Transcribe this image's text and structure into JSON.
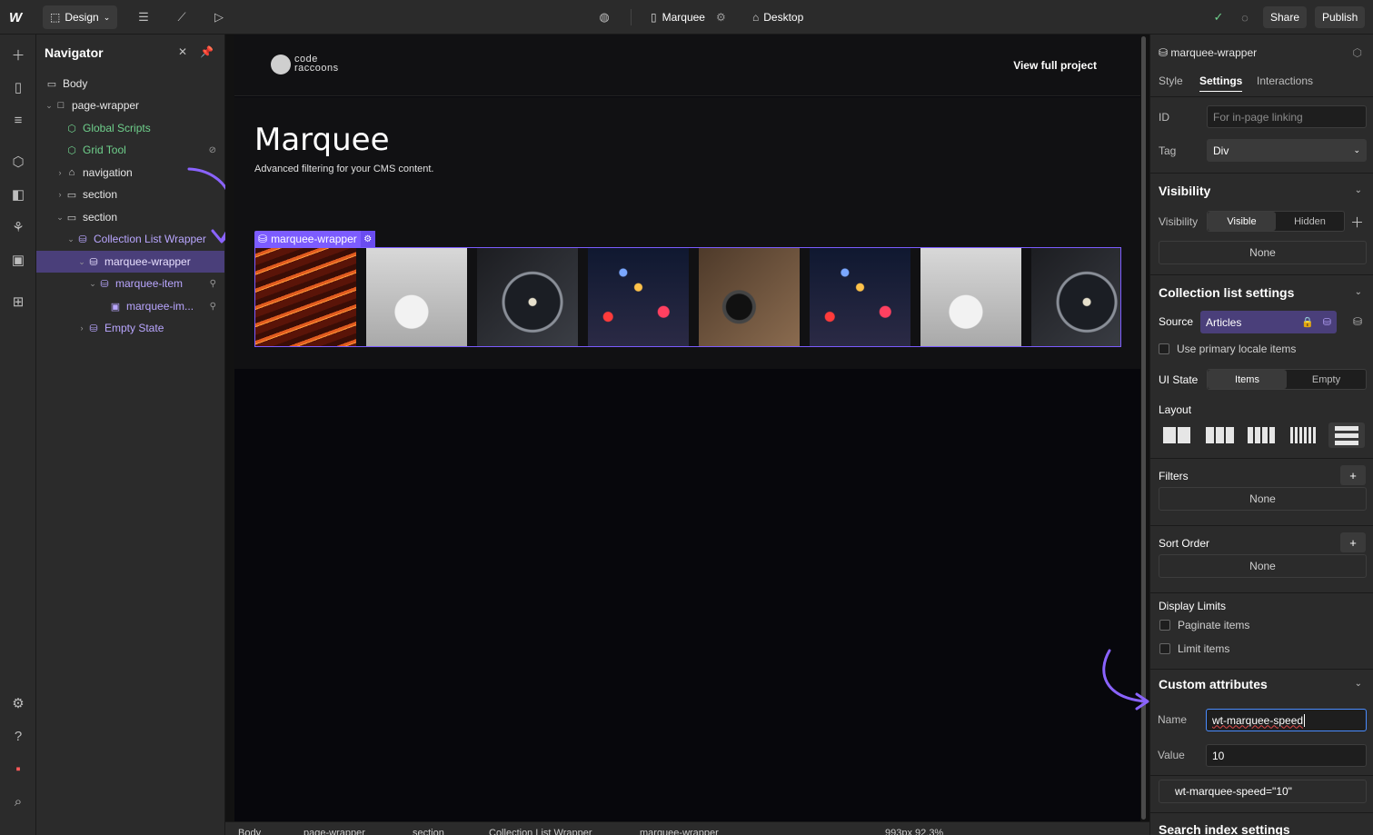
{
  "topbar": {
    "logo": "W",
    "mode_label": "Design",
    "page_name": "Marquee",
    "breakpoint_label": "Desktop",
    "share_label": "Share",
    "publish_label": "Publish"
  },
  "navigator": {
    "title": "Navigator",
    "items": [
      {
        "label": "Body"
      },
      {
        "label": "page-wrapper"
      },
      {
        "label": "Global Scripts"
      },
      {
        "label": "Grid Tool"
      },
      {
        "label": "navigation"
      },
      {
        "label": "section"
      },
      {
        "label": "section"
      },
      {
        "label": "Collection List Wrapper"
      },
      {
        "label": "marquee-wrapper"
      },
      {
        "label": "marquee-item"
      },
      {
        "label": "marquee-im..."
      },
      {
        "label": "Empty State"
      }
    ]
  },
  "canvas": {
    "logo_text_line1": "code",
    "logo_text_line2": "raccoons",
    "view_full_project": "View full project",
    "hero_title": "Marquee",
    "hero_subtitle": "Advanced filtering for your CMS content.",
    "selected_element_label": "marquee-wrapper",
    "marquee_images": [
      {
        "subject": "neon-lights",
        "color": "#c2431a"
      },
      {
        "subject": "white-cafe-chairs",
        "color": "#bdbdbd"
      },
      {
        "subject": "wristwatch",
        "color": "#2a2d33"
      },
      {
        "subject": "bokeh-lights",
        "color": "#1f2c45"
      },
      {
        "subject": "camera-on-wood",
        "color": "#6b5440"
      },
      {
        "subject": "bokeh-lights",
        "color": "#1f2c45"
      },
      {
        "subject": "white-cafe-chairs",
        "color": "#bdbdbd"
      },
      {
        "subject": "wristwatch",
        "color": "#2a2d33"
      }
    ]
  },
  "breadcrumbs": {
    "items": [
      "Body",
      "page-wrapper",
      "section",
      "Collection List Wrapper",
      "marquee-wrapper"
    ],
    "canvas_size": "993px 92.3%"
  },
  "settings_panel": {
    "element_name": "marquee-wrapper",
    "tabs": {
      "style": "Style",
      "settings": "Settings",
      "interactions": "Interactions"
    },
    "id_label": "ID",
    "id_placeholder": "For in-page linking",
    "tag_label": "Tag",
    "tag_value": "Div",
    "visibility": {
      "section_title": "Visibility",
      "row_label": "Visibility",
      "visible": "Visible",
      "hidden": "Hidden",
      "conditions": "None"
    },
    "collection": {
      "section_title": "Collection list settings",
      "source_label": "Source",
      "source_value": "Articles",
      "primary_locale": "Use primary locale items",
      "ui_state_label": "UI State",
      "ui_state_items": "Items",
      "ui_state_empty": "Empty",
      "layout_label": "Layout",
      "filters_label": "Filters",
      "filters_value": "None",
      "sort_label": "Sort Order",
      "sort_value": "None",
      "display_limits_label": "Display Limits",
      "paginate": "Paginate items",
      "limit": "Limit items"
    },
    "custom_attributes": {
      "section_title": "Custom attributes",
      "name_label": "Name",
      "name_value": "wt-marquee-speed",
      "value_label": "Value",
      "value_value": "10",
      "existing": "wt-marquee-speed=\"10\""
    },
    "search_index": {
      "section_title": "Search index settings"
    }
  },
  "colors": {
    "accent": "#7c5cff",
    "selection_bg": "#4a3f7a",
    "annotation_arrow": "#8a63ff",
    "green": "#6fd08c"
  }
}
